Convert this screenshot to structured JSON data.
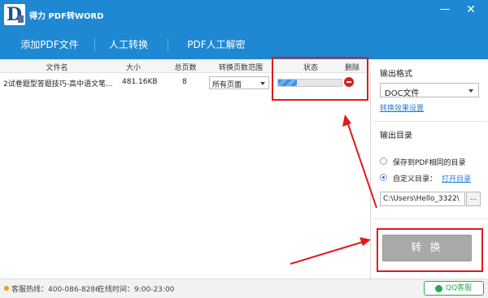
{
  "titlebar": {
    "logo_letter": "D",
    "title": "得力 PDF转WORD",
    "minimize_icon": "minimize-icon",
    "close_icon": "close-icon",
    "minimize_glyph": "—",
    "close_glyph": "✕"
  },
  "tabs": [
    {
      "label": "添加PDF文件"
    },
    {
      "label": "人工转换"
    },
    {
      "label": "PDF人工解密"
    }
  ],
  "table": {
    "headers": {
      "name": "文件名",
      "size": "大小",
      "pages": "总页数",
      "range": "转换页数范围",
      "status": "状态",
      "delete": "删除"
    },
    "rows": [
      {
        "name": "2试卷题型答题技巧-高中语文笔...",
        "size": "481.16KB",
        "pages": "8",
        "range": "所有页面",
        "progress": 0.3
      }
    ]
  },
  "side": {
    "format_title": "输出格式",
    "format_value": "DOC文件",
    "format_settings_link": "转换效果设置",
    "dir_title": "输出目录",
    "option_same": "保存到PDF相同的目录",
    "option_custom": "自定义目录：",
    "open_dir_link": "打开目录",
    "selected_option": "custom",
    "path_value": "C:\\Users\\Hello_3322\\",
    "browse_label": "...",
    "convert_label": "转 换"
  },
  "footer": {
    "hotline": "客服热线：400-086-8286",
    "hours": "在线时间：9:00-23:00",
    "qq_label": "QQ客服"
  },
  "colors": {
    "brand": "#1f88d2",
    "highlight": "#e01b1b",
    "link": "#1f7cd0",
    "qq_green": "#2fa84a"
  }
}
